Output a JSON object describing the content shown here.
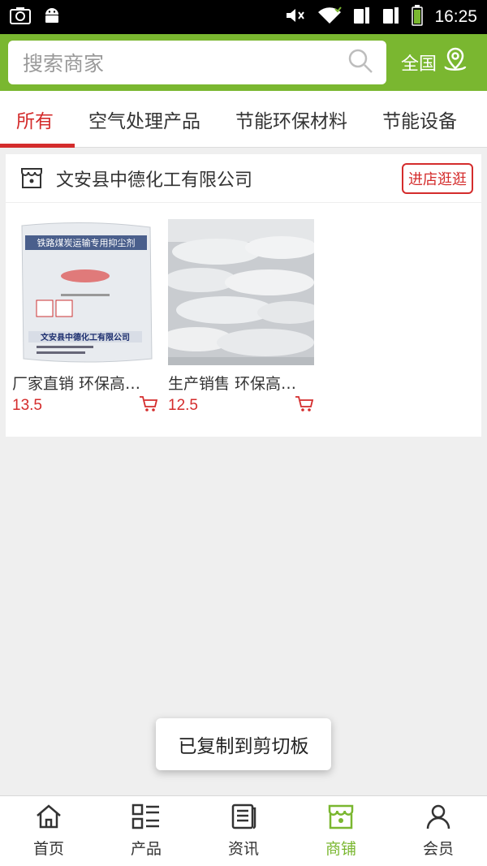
{
  "status_bar": {
    "time": "16:25",
    "icons": [
      "screenshot-icon",
      "android-icon",
      "mute-icon",
      "wifi-icon",
      "sim1-icon",
      "sim2-icon",
      "battery-icon"
    ]
  },
  "header": {
    "search_placeholder": "搜索商家",
    "region_label": "全国",
    "accent_color": "#7ab730"
  },
  "tabs": [
    {
      "label": "所有",
      "active": true
    },
    {
      "label": "空气处理产品",
      "active": false
    },
    {
      "label": "节能环保材料",
      "active": false
    },
    {
      "label": "节能设备",
      "active": false
    }
  ],
  "shop": {
    "name": "文安县中德化工有限公司",
    "visit_label": "进店逛逛",
    "products": [
      {
        "title": "厂家直销 环保高…",
        "price": "13.5",
        "bag_text_top": "铁路煤炭运输专用抑尘剂",
        "bag_text_bottom": "文安县中德化工有限公司"
      },
      {
        "title": "生产销售 环保高…",
        "price": "12.5"
      }
    ]
  },
  "toast": "已复制到剪切板",
  "bottom_nav": [
    {
      "label": "首页",
      "icon": "home-icon",
      "active": false
    },
    {
      "label": "产品",
      "icon": "product-list-icon",
      "active": false
    },
    {
      "label": "资讯",
      "icon": "news-icon",
      "active": false
    },
    {
      "label": "商铺",
      "icon": "shop-icon",
      "active": true
    },
    {
      "label": "会员",
      "icon": "member-icon",
      "active": false
    }
  ]
}
